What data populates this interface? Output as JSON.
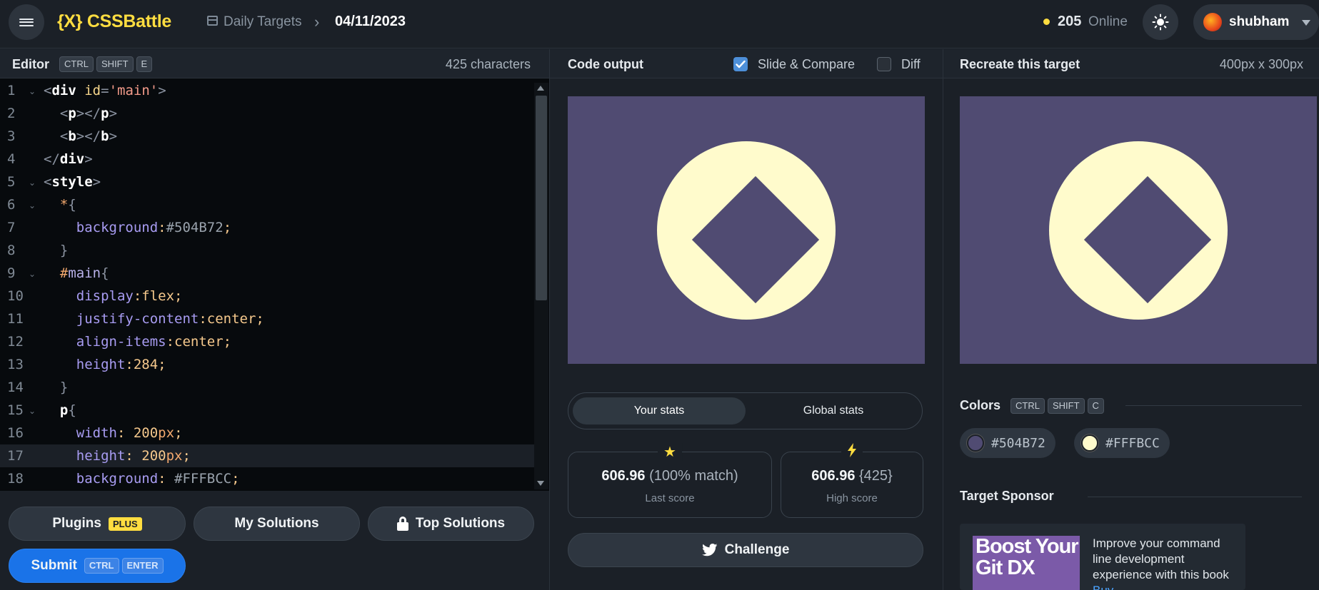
{
  "header": {
    "logo": "{X} CSSBattle",
    "breadcrumb_section": "Daily Targets",
    "breadcrumb_date": "04/11/2023",
    "online_count": "205",
    "online_label": "Online",
    "username": "shubham"
  },
  "editor": {
    "title": "Editor",
    "shortcut_keys": [
      "CTRL",
      "SHIFT",
      "E"
    ],
    "char_count": "425 characters",
    "active_line": 17
  },
  "footer": {
    "plugins_label": "Plugins",
    "plus_badge": "PLUS",
    "my_solutions_label": "My Solutions",
    "top_solutions_label": "Top Solutions",
    "submit_label": "Submit",
    "submit_keys": [
      "CTRL",
      "ENTER"
    ]
  },
  "output": {
    "title": "Code output",
    "slide_compare_label": "Slide & Compare",
    "slide_compare_checked": true,
    "diff_label": "Diff",
    "diff_checked": false,
    "tab_your_stats": "Your stats",
    "tab_global_stats": "Global stats",
    "last_score_value": "606.96",
    "last_score_match": "(100% match)",
    "last_score_label": "Last score",
    "high_score_value": "606.96",
    "high_score_chars": "{425}",
    "high_score_label": "High score",
    "challenge_label": "Challenge"
  },
  "target": {
    "title": "Recreate this target",
    "size": "400px x 300px",
    "colors_title": "Colors",
    "colors_keys": [
      "CTRL",
      "SHIFT",
      "C"
    ],
    "colors": [
      "#504B72",
      "#FFFBCC"
    ],
    "sponsor_title": "Target Sponsor",
    "sponsor_image_text": "Boost Your Git DX",
    "sponsor_text": "Improve your command line development experience with this book",
    "sponsor_link": "Buy"
  },
  "colors": {
    "bg": "#504B72",
    "fg": "#FFFBCC",
    "accent": "#FFDD40",
    "submit": "#1A73E8"
  }
}
